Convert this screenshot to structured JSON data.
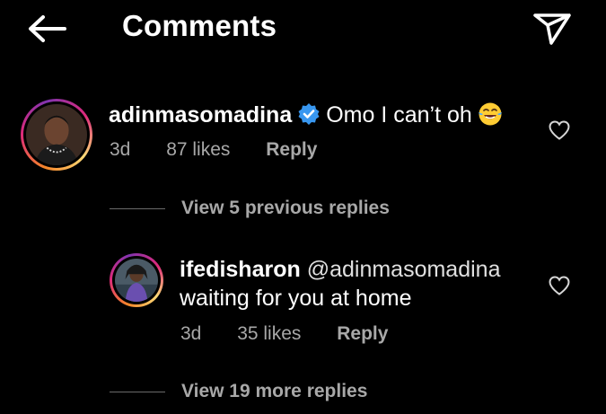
{
  "header": {
    "title": "Comments",
    "back_icon": "arrow-left-icon",
    "send_icon": "paper-plane-icon"
  },
  "comment": {
    "username": "adinmasomadina",
    "verified": true,
    "text": "Omo I can’t oh",
    "emoji": "face-with-tears-of-joy",
    "time": "3d",
    "likes": "87 likes",
    "reply_label": "Reply",
    "view_previous": "View 5 previous replies"
  },
  "reply": {
    "username": "ifedisharon",
    "mention": "@adinmasomadina",
    "text": "waiting for you at home",
    "time": "3d",
    "likes": "35 likes",
    "reply_label": "Reply",
    "view_more": "View 19 more replies"
  },
  "colors": {
    "background": "#000000",
    "text": "#ffffff",
    "secondary": "#a8a8a8",
    "verified": "#3897f0"
  }
}
